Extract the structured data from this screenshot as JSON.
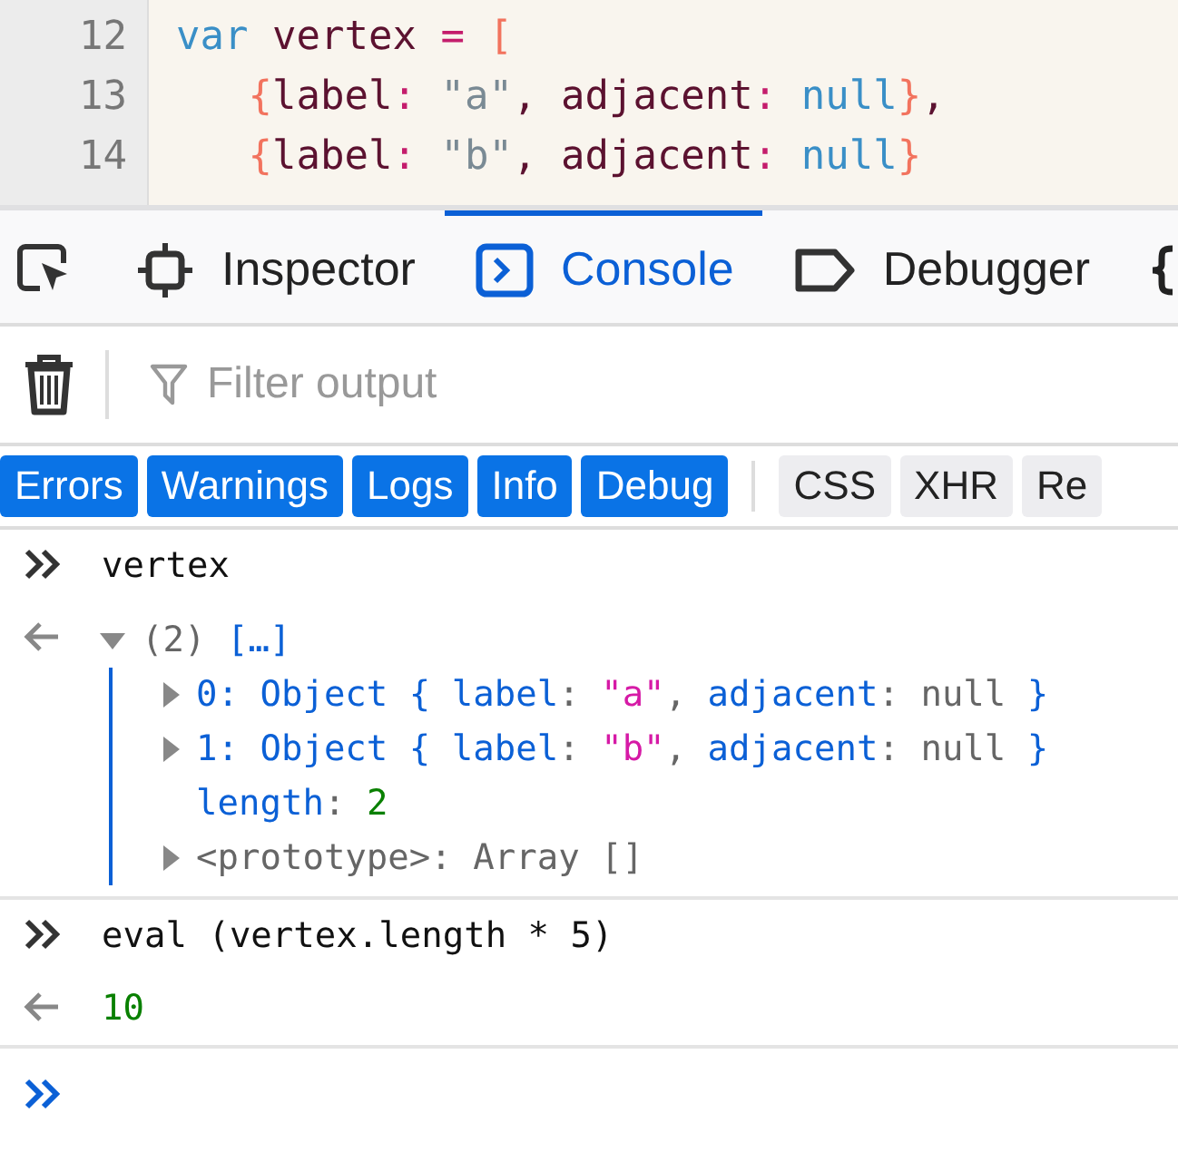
{
  "editor": {
    "lines": [
      {
        "number": "12",
        "tokens": [
          {
            "kind": "keyword",
            "text": "var "
          },
          {
            "kind": "ident",
            "text": "vertex "
          },
          {
            "kind": "op",
            "text": "= "
          },
          {
            "kind": "bracket",
            "text": "["
          }
        ]
      },
      {
        "number": "13",
        "tokens": [
          {
            "kind": "bracket",
            "text": "   {"
          },
          {
            "kind": "ident",
            "text": "label"
          },
          {
            "kind": "op",
            "text": ": "
          },
          {
            "kind": "string",
            "text": "\"a\""
          },
          {
            "kind": "ident",
            "text": ", adjacent"
          },
          {
            "kind": "op",
            "text": ": "
          },
          {
            "kind": "keyword",
            "text": "null"
          },
          {
            "kind": "bracket",
            "text": "}"
          },
          {
            "kind": "ident",
            "text": ","
          }
        ]
      },
      {
        "number": "14",
        "tokens": [
          {
            "kind": "bracket",
            "text": "   {"
          },
          {
            "kind": "ident",
            "text": "label"
          },
          {
            "kind": "op",
            "text": ": "
          },
          {
            "kind": "string",
            "text": "\"b\""
          },
          {
            "kind": "ident",
            "text": ", adjacent"
          },
          {
            "kind": "op",
            "text": ": "
          },
          {
            "kind": "keyword",
            "text": "null"
          },
          {
            "kind": "bracket",
            "text": "}"
          }
        ]
      }
    ]
  },
  "tabs": [
    {
      "kind": "picker",
      "selected": false
    },
    {
      "kind": "inspector",
      "label": "Inspector",
      "selected": false
    },
    {
      "kind": "console",
      "label": "Console",
      "selected": true
    },
    {
      "kind": "debugger",
      "label": "Debugger",
      "selected": false
    },
    {
      "kind": "style",
      "selected": false
    }
  ],
  "filter": {
    "placeholder": "Filter output"
  },
  "levels": [
    {
      "label": "Errors",
      "selected": true
    },
    {
      "label": "Warnings",
      "selected": true
    },
    {
      "label": "Logs",
      "selected": true
    },
    {
      "label": "Info",
      "selected": true
    },
    {
      "label": "Debug",
      "selected": true
    },
    {
      "label": "CSS",
      "selected": false
    },
    {
      "label": "XHR",
      "selected": false
    },
    {
      "label": "Re",
      "selected": false
    }
  ],
  "messages": [
    {
      "kind": "input",
      "text": "vertex"
    },
    {
      "kind": "tree",
      "expanded": true,
      "summary": [
        {
          "kind": "punct",
          "text": "(2) "
        },
        {
          "kind": "key",
          "text": "[…]"
        }
      ],
      "children": [
        {
          "expandable": true,
          "tokens": [
            {
              "kind": "key",
              "text": "0: Object { label"
            },
            {
              "kind": "punct",
              "text": ": "
            },
            {
              "kind": "string",
              "text": "\"a\""
            },
            {
              "kind": "punct",
              "text": ", "
            },
            {
              "kind": "key",
              "text": "adjacent"
            },
            {
              "kind": "punct",
              "text": ": null "
            },
            {
              "kind": "key",
              "text": "}"
            }
          ]
        },
        {
          "expandable": true,
          "tokens": [
            {
              "kind": "key",
              "text": "1: Object { label"
            },
            {
              "kind": "punct",
              "text": ": "
            },
            {
              "kind": "string",
              "text": "\"b\""
            },
            {
              "kind": "punct",
              "text": ", "
            },
            {
              "kind": "key",
              "text": "adjacent"
            },
            {
              "kind": "punct",
              "text": ": null "
            },
            {
              "kind": "key",
              "text": "}"
            }
          ]
        },
        {
          "expandable": false,
          "tokens": [
            {
              "kind": "key",
              "text": "length"
            },
            {
              "kind": "punct",
              "text": ": "
            },
            {
              "kind": "number",
              "text": "2"
            }
          ]
        },
        {
          "expandable": true,
          "tokens": [
            {
              "kind": "punct",
              "text": "<prototype>: Array []"
            }
          ]
        }
      ]
    },
    {
      "kind": "input",
      "text": "eval (vertex.length * 5)"
    },
    {
      "kind": "result",
      "text": "10"
    }
  ]
}
